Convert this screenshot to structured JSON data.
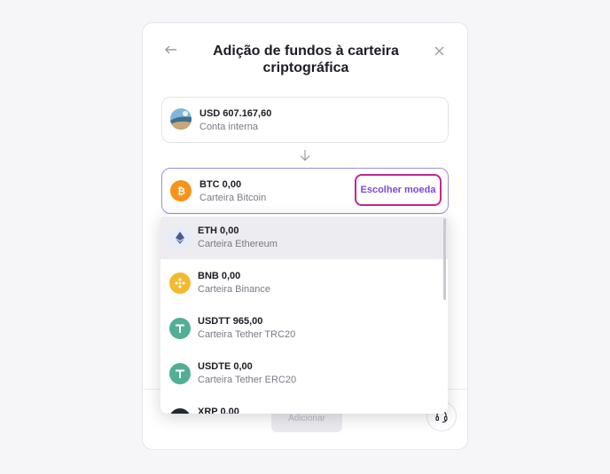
{
  "modal": {
    "title_line1": "Adição de fundos à carteira",
    "title_line2": "criptográfica"
  },
  "source": {
    "amount": "USD 607.167,60",
    "label": "Conta interna"
  },
  "destination": {
    "amount": "BTC 0,00",
    "label": "Carteira Bitcoin",
    "choose_label": "Escolher moeda"
  },
  "list": {
    "items": [
      {
        "amount": "ETH 0,00",
        "label": "Carteira Ethereum",
        "icon": "ethereum-icon",
        "color": "#e7ecfa"
      },
      {
        "amount": "BNB 0,00",
        "label": "Carteira Binance",
        "icon": "binance-icon",
        "color": "#f3ba2f"
      },
      {
        "amount": "USDTT 965,00",
        "label": "Carteira Tether TRC20",
        "icon": "tether-icon",
        "color": "#50af95"
      },
      {
        "amount": "USDTE 0,00",
        "label": "Carteira Tether ERC20",
        "icon": "tether-icon",
        "color": "#50af95"
      },
      {
        "amount": "XRP 0,00",
        "label": "",
        "icon": "xrp-icon",
        "color": "#23292f"
      }
    ]
  },
  "footer": {
    "add_label": "Adicionar"
  }
}
